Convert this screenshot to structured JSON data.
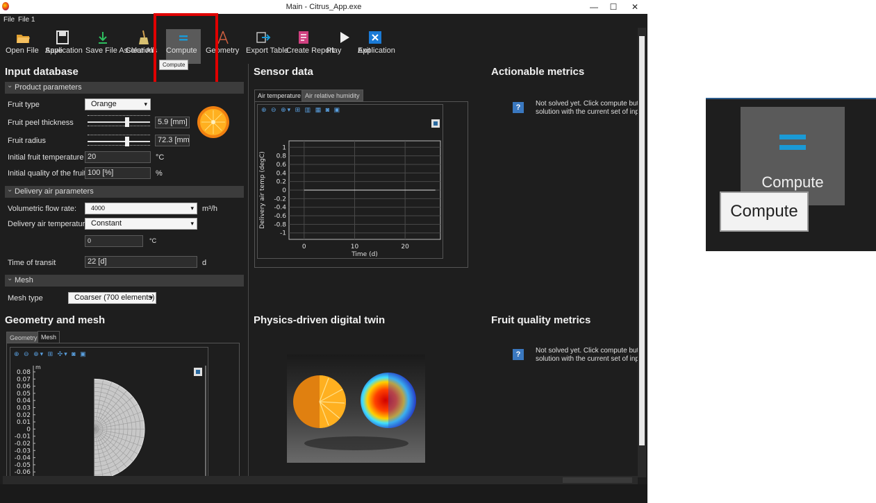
{
  "window": {
    "title": "Main - Citrus_App.exe",
    "minimize": "—",
    "maximize": "☐",
    "close": "✕"
  },
  "menu": [
    "File",
    "File 1"
  ],
  "ribbon": {
    "buttons": [
      {
        "label1": "Open File",
        "label2": ""
      },
      {
        "label1": "Save",
        "label2": "Application"
      },
      {
        "label1": "Save File As",
        "label2": ""
      },
      {
        "label1": "Clear All",
        "label2": "Solutions"
      },
      {
        "label1": "Compute",
        "label2": ""
      },
      {
        "label1": "Geometry",
        "label2": ""
      },
      {
        "label1": "Export Table",
        "label2": ""
      },
      {
        "label1": "Create Report",
        "label2": ""
      },
      {
        "label1": "Play",
        "label2": ""
      },
      {
        "label1": "Exit",
        "label2": "Application"
      }
    ],
    "tooltip": "Compute"
  },
  "input_database": {
    "title": "Input database",
    "product_parameters": {
      "header": "Product parameters",
      "fruit_type_label": "Fruit type",
      "fruit_type_value": "Orange",
      "peel_label": "Fruit peel thickness",
      "peel_value": "5.9 [mm]",
      "radius_label": "Fruit radius",
      "radius_value": "72.3 [mm]",
      "init_temp_label": "Initial fruit temperature",
      "init_temp_value": "20",
      "init_temp_unit": "°C",
      "init_quality_label": "Initial quality of the fruit",
      "init_quality_value": "100 [%]",
      "init_quality_unit": "%"
    },
    "delivery_air": {
      "header": "Delivery air parameters",
      "flow_label": "Volumetric flow rate:",
      "flow_value": "4000",
      "flow_unit": "m³/h",
      "temp_label": "Delivery air temperature",
      "temp_value": "Constant",
      "temp_field": "0",
      "temp_unit": "°C",
      "transit_label": "Time of transit",
      "transit_value": "22 [d]",
      "transit_unit": "d"
    },
    "mesh": {
      "header": "Mesh",
      "type_label": "Mesh type",
      "type_value": "Coarser (700 elements)"
    }
  },
  "sensor_data": {
    "title": "Sensor data",
    "tabs": [
      "Air temperature",
      "Air relative humidity"
    ]
  },
  "chart_data": {
    "type": "line",
    "title": "",
    "xlabel": "Time (d)",
    "ylabel": "Delivery air temp (degC)",
    "xlim": [
      -3,
      27
    ],
    "ylim": [
      -1.15,
      1.15
    ],
    "xticks": [
      "0",
      "10",
      "20"
    ],
    "yticks": [
      "1",
      "0.8",
      "0.6",
      "0.4",
      "0.2",
      "0",
      "-0.2",
      "-0.4",
      "-0.6",
      "-0.8",
      "-1"
    ],
    "series": [
      {
        "x": [
          0,
          26
        ],
        "y": [
          0,
          0
        ]
      }
    ],
    "grid": true
  },
  "actionable_metrics": {
    "title": "Actionable metrics",
    "message_line1": "Not solved yet. Click compute butto",
    "message_line2": "solution with the current set of input"
  },
  "geometry_mesh": {
    "title": "Geometry and mesh",
    "tabs": [
      "Geometry",
      "Mesh"
    ],
    "axis_unit": "m",
    "yticks": [
      "0.08",
      "0.07",
      "0.06",
      "0.05",
      "0.04",
      "0.03",
      "0.02",
      "0.01",
      "0",
      "-0.01",
      "-0.02",
      "-0.03",
      "-0.04",
      "-0.05",
      "-0.06"
    ]
  },
  "digital_twin": {
    "title": "Physics-driven digital twin"
  },
  "fruit_quality": {
    "title": "Fruit quality metrics",
    "message_line1": "Not solved yet. Click compute butto",
    "message_line2": "solution with the current set of input"
  },
  "zoom_inset": {
    "button_label": "Compute",
    "tooltip": "Compute"
  },
  "colors": {
    "accent": "#1a9ad6",
    "highlight": "#e00000",
    "background": "#1e1e1e"
  }
}
